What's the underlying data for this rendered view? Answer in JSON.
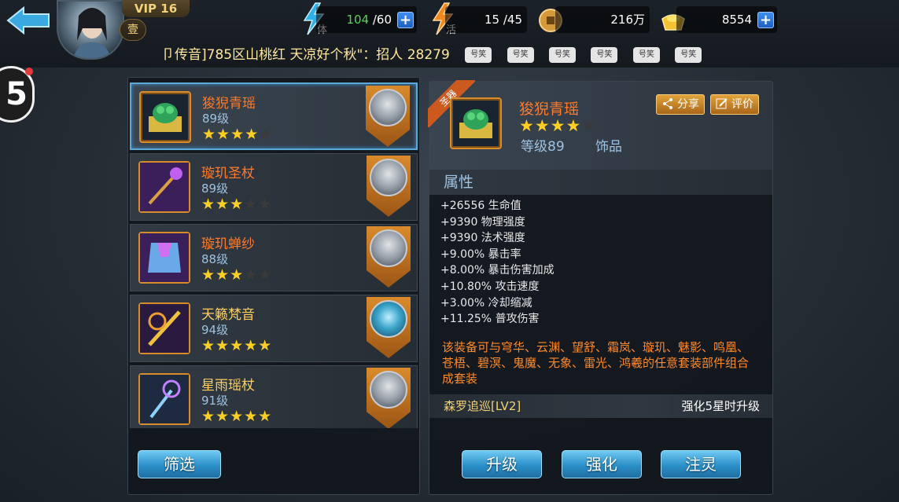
{
  "header": {
    "vip_label": "VIP 16",
    "rank_label": "壹",
    "resources": [
      {
        "name": "stamina",
        "icon": "stamina-lightning-icon",
        "icon_char": "体",
        "current": "104",
        "max": "/60",
        "has_plus": true
      },
      {
        "name": "activity",
        "icon": "activity-lightning-icon",
        "icon_char": "活",
        "current": "15",
        "max": "/45",
        "has_plus": false
      },
      {
        "name": "coins",
        "icon": "copper-coin-icon",
        "value": "216万",
        "has_plus": false
      },
      {
        "name": "gold",
        "icon": "gold-ingot-icon",
        "value": "8554",
        "has_plus": true
      }
    ],
    "plus_glyph": "+"
  },
  "broadcast": {
    "text": "卩传音]785区山桃红 天凉好个秋\"：招人 28279",
    "emotes": [
      "号笑",
      "号笑",
      "号笑",
      "号笑",
      "号笑",
      "号笑"
    ]
  },
  "side_badge": {
    "label": "5"
  },
  "equipment_list": [
    {
      "name": "狻猊青瑶",
      "level": "89级",
      "stars": 4,
      "max_stars": 5,
      "name_color": "orange",
      "hero": "silver",
      "selected": true
    },
    {
      "name": "璇玑圣杖",
      "level": "89级",
      "stars": 3,
      "max_stars": 5,
      "name_color": "orange",
      "hero": "silver",
      "selected": false
    },
    {
      "name": "璇玑蝉纱",
      "level": "88级",
      "stars": 3,
      "max_stars": 5,
      "name_color": "orange",
      "hero": "silver",
      "selected": false
    },
    {
      "name": "天籁梵音",
      "level": "94级",
      "stars": 5,
      "max_stars": 5,
      "name_color": "gold",
      "hero": "blue",
      "selected": false
    },
    {
      "name": "星雨瑶杖",
      "level": "91级",
      "stars": 5,
      "max_stars": 5,
      "name_color": "gold",
      "hero": "silver",
      "selected": false
    }
  ],
  "filter_button": "筛选",
  "detail": {
    "ribbon": "圣器",
    "name": "狻猊青瑶",
    "stars": 4,
    "max_stars": 5,
    "level": "等级89",
    "type": "饰品",
    "share_label": "分享",
    "rate_label": "评价",
    "attr_title": "属性",
    "attributes": [
      "+26556 生命值",
      "+9390 物理强度",
      "+9390 法术强度",
      "+9.00% 暴击率",
      "+8.00% 暴击伤害加成",
      "+10.80% 攻击速度",
      "+3.00% 冷却缩减",
      "+11.25% 普攻伤害"
    ],
    "set_description": "该装备可与穹华、云渊、望舒、霜岚、璇玑、魅影、鸣凰、苍梧、碧溟、鬼魔、无象、雷光、鸿羲的任意套装部件组合成套装",
    "set_name": "森罗追巡[LV2]",
    "set_note": "强化5星时升级"
  },
  "actions": {
    "upgrade": "升级",
    "enhance": "强化",
    "infuse": "注灵"
  },
  "colors": {
    "accent_blue": "#2b8fc8",
    "star_gold": "#ffcf24",
    "item_orange": "#ff7a2a",
    "item_gold": "#ffd060",
    "stamina_green": "#58d45a"
  }
}
